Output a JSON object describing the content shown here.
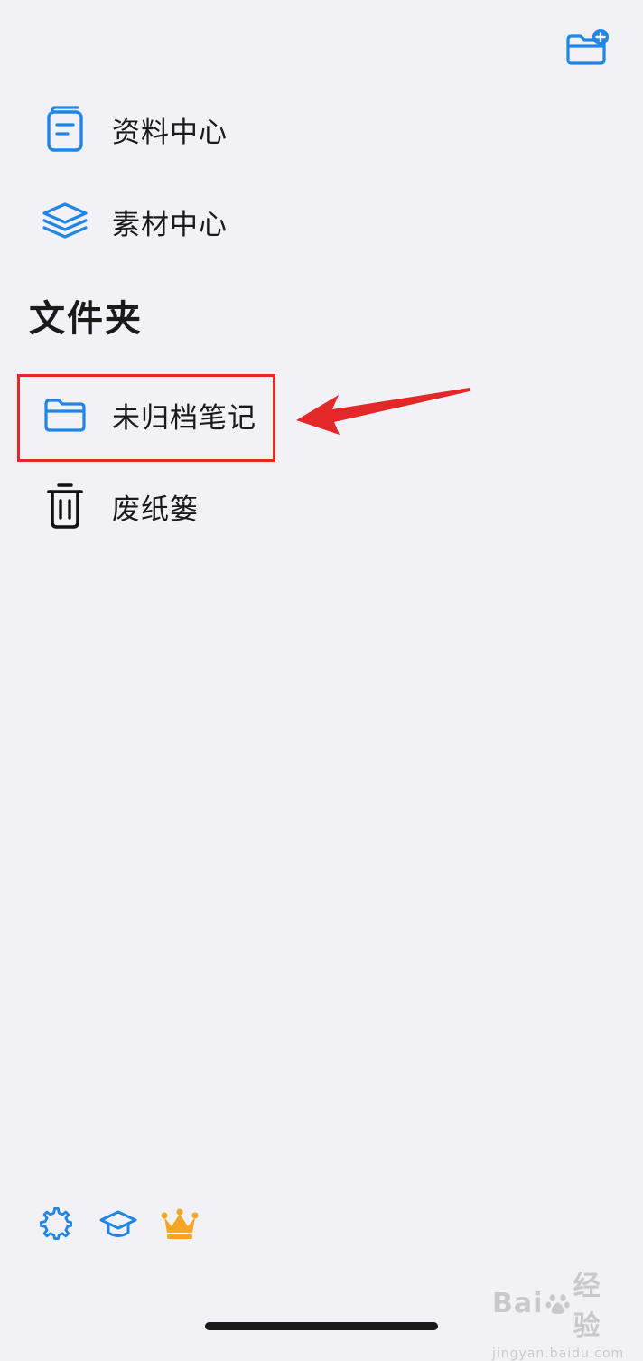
{
  "header": {
    "new_folder_icon": "folder-plus-icon",
    "accent_color": "#1f86e8"
  },
  "nav": {
    "items": [
      {
        "label": "资料中心",
        "icon": "document-icon"
      },
      {
        "label": "素材中心",
        "icon": "layers-icon"
      }
    ]
  },
  "folders": {
    "title": "文件夹",
    "items": [
      {
        "label": "未归档笔记",
        "icon": "folder-icon",
        "highlighted": true
      },
      {
        "label": "废纸篓",
        "icon": "trash-icon"
      }
    ]
  },
  "annotation": {
    "color": "#e42727",
    "shape": "arrow-pointing-left"
  },
  "bottom_bar": {
    "icons": [
      "gear-icon",
      "graduation-cap-icon",
      "crown-icon"
    ],
    "crown_color": "#f5a623"
  },
  "watermark": {
    "brand_left": "Bai",
    "brand_right": "经验",
    "domain": "jingyan.baidu.com"
  }
}
